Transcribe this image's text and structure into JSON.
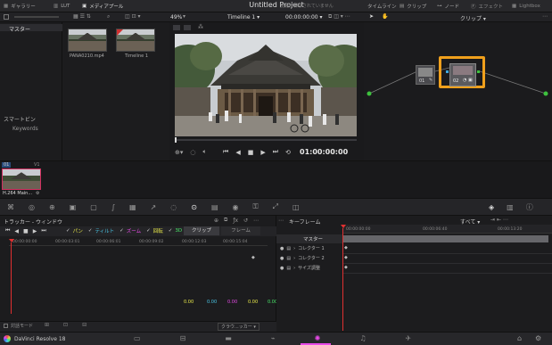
{
  "topbar": {
    "gallery": "ギャラリー",
    "lut": "LUT",
    "media_pool": "メディアプール",
    "project_title": "Untitled Project",
    "subtitle": "変更が保存されていません",
    "timeline_tab": "タイムライン",
    "clips_tab": "クリップ",
    "nodes_tab": "ノード",
    "effects_tab": "エフェクト",
    "lightbox_tab": "Lightbox"
  },
  "toolbar2": {
    "zoom": "49%",
    "timeline_name": "Timeline 1",
    "timecode": "00:00:00:00",
    "clip_dropdown": "クリップ"
  },
  "left_panel": {
    "master": "マスター",
    "smart_bins": "スマートビン",
    "keywords": "Keywords"
  },
  "media_pool": {
    "items": [
      {
        "label": "PANA0210.mp4"
      },
      {
        "label": "Timeline 1"
      }
    ]
  },
  "viewer": {
    "timecode": "01:00:00:00"
  },
  "nodes": {
    "node1_label": "01",
    "node2_label": "02"
  },
  "clipstrip": {
    "clip_number": "01",
    "track": "V1",
    "clip_name": "H.264 Main..."
  },
  "tracker": {
    "title": "トラッカー - ウィンドウ",
    "pan": "パン",
    "tilt": "ティルト",
    "zoom": "ズーム",
    "rotate": "回転",
    "three_d": "3D",
    "clip_btn": "クリップ",
    "frame_btn": "フレーム",
    "ruler": [
      "00:00:00:00",
      "00:00:03:01",
      "00:00:06:01",
      "00:00:09:02",
      "00:00:12:03",
      "00:00:15:04"
    ],
    "values": [
      "0.00",
      "0.00",
      "0.00",
      "0.00",
      "0.00"
    ],
    "interactive_mode": "対話モード",
    "cloud_tracker": "クラウ...ッカー"
  },
  "keyframe": {
    "title": "キーフレーム",
    "all": "すべて",
    "ruler": [
      "00:00:00:00",
      "00:00:06:40",
      "00:00:13:20"
    ],
    "rows": [
      "マスター",
      "コレクター 1",
      "コレクター 2",
      "サイズ調整"
    ]
  },
  "bottombar": {
    "app_name": "DaVinci Resolve 18"
  },
  "colors": {
    "accent_orange": "#f0a01c",
    "playhead_red": "#e03030",
    "pan_color": "#e8e84a",
    "tilt_color": "#4ac8e8",
    "zoom_color": "#e84ae8",
    "rotate_color": "#e8e84a",
    "three_d_color": "#4ae86a",
    "green_node_dot": "#3ec23e"
  }
}
